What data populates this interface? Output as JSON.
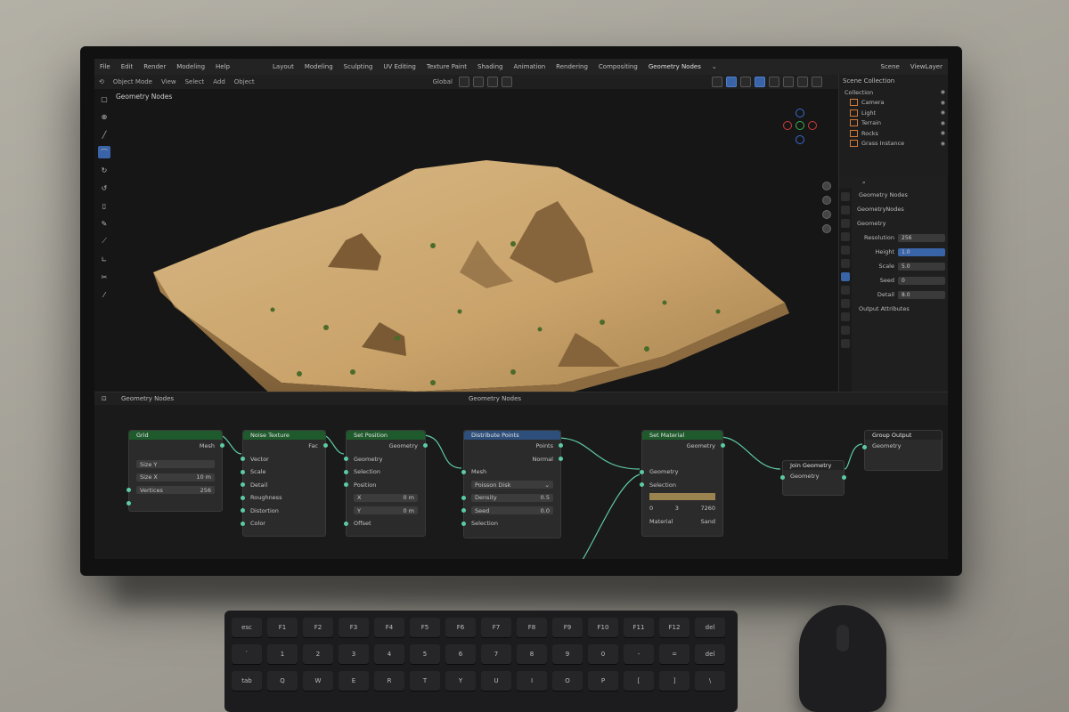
{
  "menu": {
    "items": [
      "File",
      "Edit",
      "Render",
      "Modeling",
      "Help"
    ],
    "tabs": [
      "Layout",
      "Modeling",
      "Sculpting",
      "UV Editing",
      "Texture Paint",
      "Shading",
      "Animation",
      "Rendering",
      "Compositing",
      "Geometry Nodes"
    ],
    "scene": "Scene",
    "view_layer": "ViewLayer"
  },
  "toolbar": {
    "items": [
      "Object Mode",
      "View",
      "Select",
      "Add",
      "Object"
    ],
    "orientation": "Global"
  },
  "viewport": {
    "title": "Geometry Nodes"
  },
  "outliner": {
    "title": "Scene Collection",
    "rows": [
      {
        "label": "Collection"
      },
      {
        "label": "Camera"
      },
      {
        "label": "Light"
      },
      {
        "label": "Terrain"
      },
      {
        "label": "Rocks"
      },
      {
        "label": "Grass Instance"
      }
    ]
  },
  "properties": {
    "modifier": "GeometryNodes",
    "header": "Geometry Nodes",
    "field1": "Geometry",
    "rows": [
      {
        "label": "Resolution",
        "value": "256"
      },
      {
        "label": "Height",
        "value": "1.0"
      },
      {
        "label": "Scale",
        "value": "5.0"
      },
      {
        "label": "Seed",
        "value": "0"
      },
      {
        "label": "Detail",
        "value": "8.0"
      }
    ],
    "footer": "Output Attributes"
  },
  "node_editor": {
    "title": "Geometry Nodes",
    "center_title": "Geometry Nodes",
    "nodes": {
      "n1": {
        "title": "Grid",
        "out": "Mesh",
        "rows": [
          {
            "label": "Size X",
            "value": "10 m"
          },
          {
            "label": "Vertices",
            "value": "256"
          }
        ],
        "extra": "Size Y"
      },
      "n2": {
        "title": "Noise Texture",
        "out": "Fac",
        "inputs": [
          "Vector",
          "Scale",
          "Detail",
          "Roughness",
          "Distortion",
          "Color"
        ]
      },
      "n3": {
        "title": "Set Position",
        "out": "Geometry",
        "inputs": [
          "Geometry",
          "Selection",
          "Position"
        ],
        "fields": [
          {
            "label": "X",
            "value": "0 m"
          },
          {
            "label": "Y",
            "value": "0 m"
          }
        ],
        "extra": "Offset"
      },
      "n4": {
        "title": "Distribute Points",
        "outs": [
          "Points",
          "Normal"
        ],
        "inputs": [
          "Mesh",
          "Selection"
        ],
        "fields": [
          {
            "label": "Density",
            "value": "0.5"
          },
          {
            "label": "Seed",
            "value": "0.0"
          }
        ],
        "extra": "Poisson Disk"
      },
      "n5": {
        "title": "Set Material",
        "out": "Geometry",
        "inputs": [
          "Geometry",
          "Selection"
        ],
        "stats": {
          "a": "0",
          "b": "3",
          "c": "7260"
        },
        "footer": "Material",
        "footer2": "Sand"
      },
      "n6": {
        "title": "Join Geometry",
        "label": "Geometry"
      },
      "n7": {
        "title": "Group Output",
        "label": "Geometry"
      }
    }
  },
  "keyboard": {
    "row1": [
      "esc",
      "F1",
      "F2",
      "F3",
      "F4",
      "F5",
      "F6",
      "F7",
      "F8",
      "F9",
      "F10",
      "F11",
      "F12",
      "del"
    ],
    "row2": [
      "`",
      "1",
      "2",
      "3",
      "4",
      "5",
      "6",
      "7",
      "8",
      "9",
      "0",
      "-",
      "=",
      "del"
    ],
    "row3": [
      "tab",
      "Q",
      "W",
      "E",
      "R",
      "T",
      "Y",
      "U",
      "I",
      "O",
      "P",
      "[",
      "]",
      "\\"
    ]
  },
  "colors": {
    "node_green": "#1e5a2c",
    "node_blue": "#2e4f7c",
    "socket": "#5dcba2",
    "sand": "#c9a36a",
    "accent": "#3a64a8"
  }
}
